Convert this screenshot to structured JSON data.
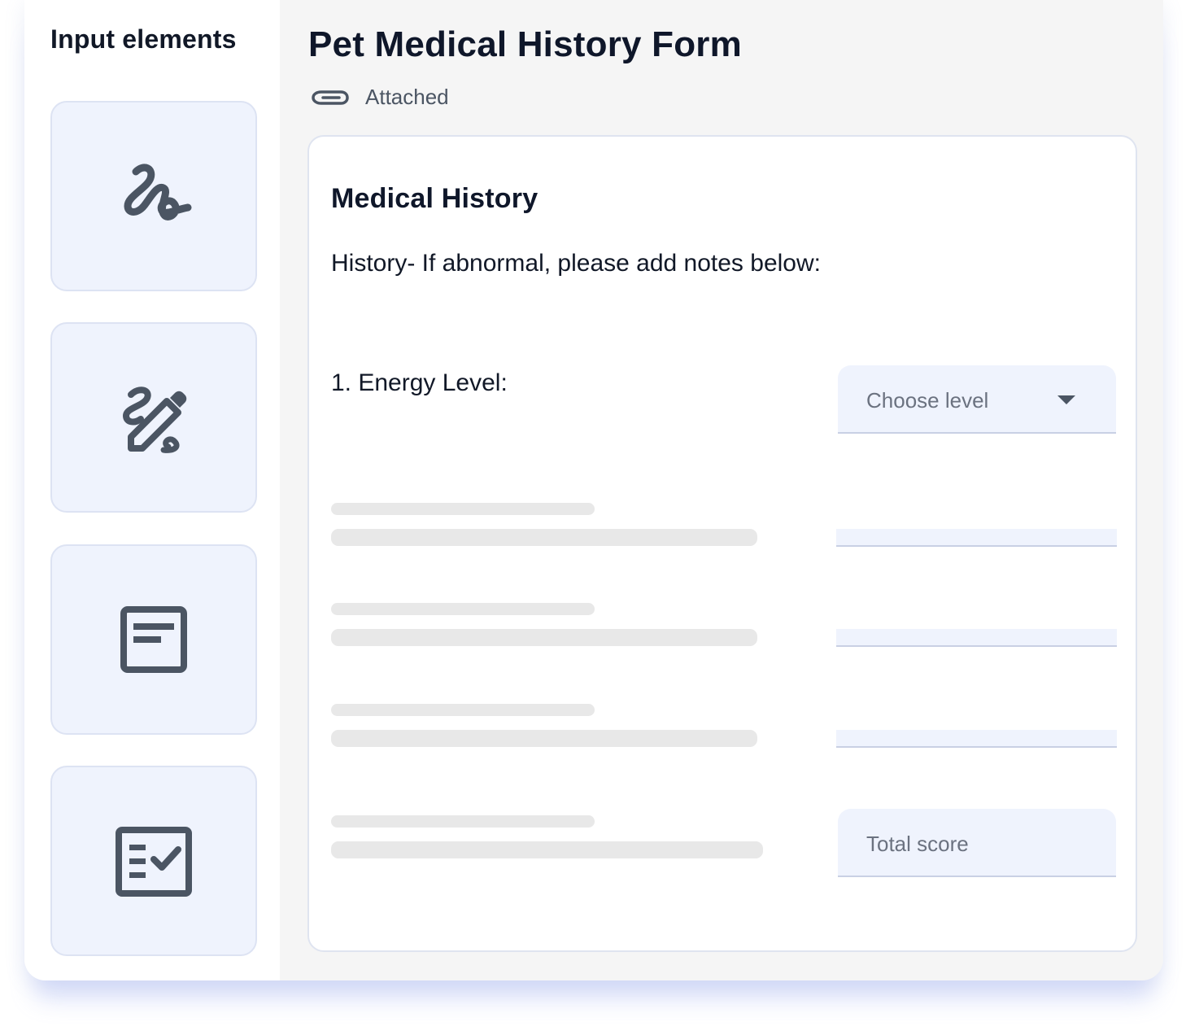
{
  "sidebar": {
    "title": "Input elements",
    "tiles": [
      {
        "icon": "signature-icon"
      },
      {
        "icon": "draw-edit-icon"
      },
      {
        "icon": "text-note-icon"
      },
      {
        "icon": "checklist-icon"
      }
    ]
  },
  "form": {
    "title": "Pet Medical History Form",
    "attachment_label": "Attached",
    "section_title": "Medical History",
    "instruction": "History- If abnormal, please add notes below:",
    "question_1": "1. Energy Level:",
    "select_placeholder": "Choose level",
    "total_score_placeholder": "Total score"
  },
  "colors": {
    "tile_background": "#eff3fd",
    "icon": "#4b5563",
    "heading": "#0f172a",
    "skeleton": "#e8e8e8"
  }
}
